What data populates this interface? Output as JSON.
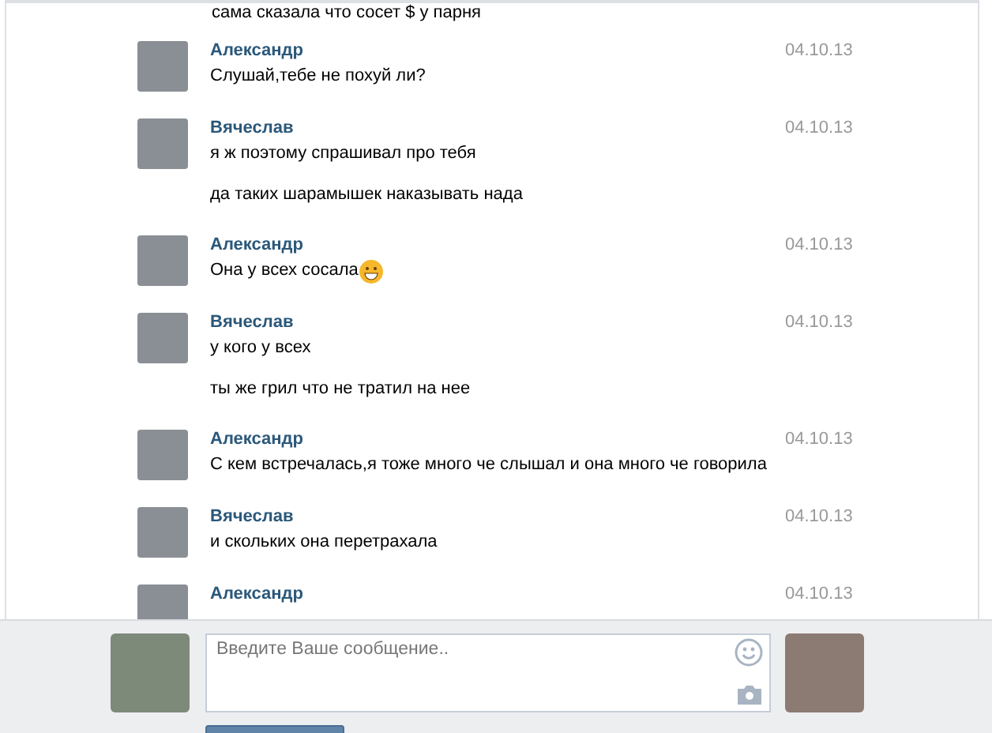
{
  "previous_line": "сама сказала что сосет $ у парня",
  "messages": [
    {
      "author": "Александр",
      "date": "04.10.13",
      "lines": [
        {
          "text": "Слушай,тебе не похуй ли?"
        }
      ]
    },
    {
      "author": "Вячеслав",
      "date": "04.10.13",
      "lines": [
        {
          "text": "я ж поэтому спрашивал про тебя"
        },
        {
          "text": "да таких шарамышек наказывать нада"
        }
      ]
    },
    {
      "author": "Александр",
      "date": "04.10.13",
      "lines": [
        {
          "text": "Она у всех сосала",
          "emoji": true
        }
      ]
    },
    {
      "author": "Вячеслав",
      "date": "04.10.13",
      "lines": [
        {
          "text": "у кого у всех"
        },
        {
          "text": "ты же грил что не тратил на нее"
        }
      ]
    },
    {
      "author": "Александр",
      "date": "04.10.13",
      "lines": [
        {
          "text": "С кем встречалась,я тоже много че слышал и она много че говорила"
        }
      ]
    },
    {
      "author": "Вячеслав",
      "date": "04.10.13",
      "lines": [
        {
          "text": "и скольких она перетрахала"
        }
      ]
    },
    {
      "author": "Александр",
      "date": "04.10.13"
    }
  ],
  "composer": {
    "placeholder": "Введите Ваше сообщение.."
  }
}
